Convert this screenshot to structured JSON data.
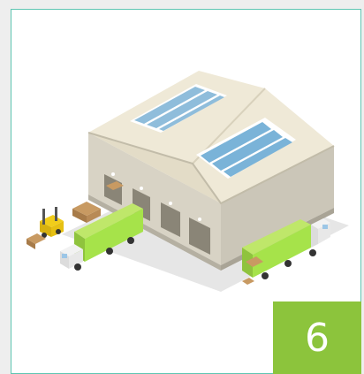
{
  "card": {
    "number": "6",
    "illustration": "isometric-warehouse-with-trucks",
    "colors": {
      "border": "#5ec6b2",
      "badge": "#8cc43c",
      "page_background": "#eeeeee",
      "truck_cargo": "#a6e34a"
    }
  }
}
